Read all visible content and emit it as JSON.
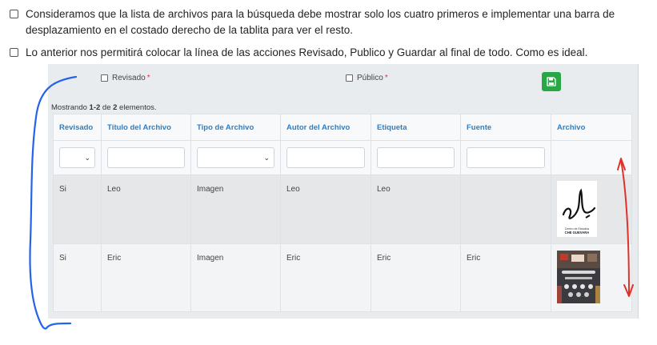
{
  "checklist": [
    {
      "text": "Consideramos que la lista de archivos para la búsqueda debe mostrar solo los cuatro primeros e implementar una barra de desplazamiento en el costado derecho de la tablita para ver el resto.",
      "checked": false
    },
    {
      "text": "Lo anterior nos permitirá colocar la línea de las acciones Revisado, Publico y Guardar al final de todo. Como es ideal.",
      "checked": false
    }
  ],
  "panel": {
    "revisado_label": "Revisado",
    "publico_label": "Público",
    "required_mark": "*",
    "showing_prefix": "Mostrando ",
    "showing_range": "1-2",
    "showing_mid": " de ",
    "showing_total": "2",
    "showing_suffix": " elementos.",
    "save_icon": "save-icon",
    "save_color": "#28a745"
  },
  "table": {
    "columns": [
      "Revisado",
      "Título del Archivo",
      "Tipo de Archivo",
      "Autor del Archivo",
      "Etiqueta",
      "Fuente",
      "Archivo"
    ],
    "rows": [
      {
        "revisado": "Si",
        "titulo": "Leo",
        "tipo": "Imagen",
        "autor": "Leo",
        "etiqueta": "Leo",
        "fuente": "",
        "archivo_caption_1": "Centro de Estudios",
        "archivo_caption_2": "CHE GUEVARA"
      },
      {
        "revisado": "Si",
        "titulo": "Eric",
        "tipo": "Imagen",
        "autor": "Eric",
        "etiqueta": "Eric",
        "fuente": "Eric"
      }
    ]
  },
  "annotation_colors": {
    "blue": "#2563eb",
    "red": "#e0312b"
  }
}
